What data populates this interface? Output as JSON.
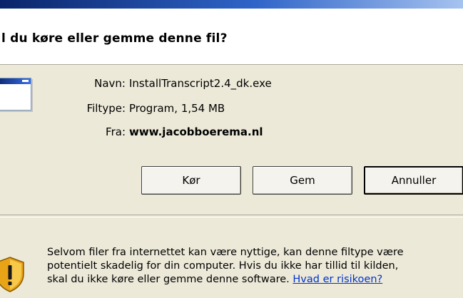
{
  "dialog": {
    "question": "l du køre eller gemme denne fil?",
    "file": {
      "name_label": "Navn:",
      "name_value": "InstallTranscript2.4_dk.exe",
      "type_label": "Filtype:",
      "type_value": "Program, 1,54 MB",
      "from_label": "Fra:",
      "from_value": "www.jacobboerema.nl"
    },
    "buttons": {
      "run": "Kør",
      "save": "Gem",
      "cancel": "Annuller"
    },
    "warning": {
      "line1": "Selvom filer fra internettet kan være nyttige, kan denne filtype være",
      "line2": "potentielt skadelig for din computer. Hvis du ikke har tillid til kilden,",
      "line3": "skal du ikke køre eller gemme denne software.",
      "link": "Hvad er risikoen?"
    },
    "icons": {
      "file": "program-window-icon",
      "warning": "security-shield-warning-icon"
    },
    "colors": {
      "link": "#0033cc",
      "title_bar": "#0a246a",
      "shield": "#e8a317"
    }
  }
}
